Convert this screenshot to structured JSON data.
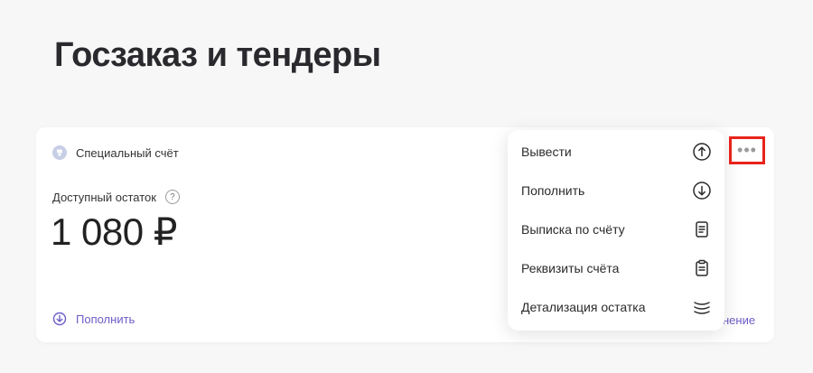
{
  "page": {
    "title": "Госзаказ и тендеры"
  },
  "account": {
    "name": "Специальный счёт",
    "balance_label": "Доступный остаток",
    "balance_amount": "1 080 ₽",
    "help_symbol": "?",
    "topup_label": "Пополнить",
    "partial_link_label": "нение"
  },
  "more_button": {
    "symbol": "•••"
  },
  "menu": {
    "items": [
      {
        "label": "Вывести",
        "icon": "upload-circle-icon"
      },
      {
        "label": "Пополнить",
        "icon": "download-circle-icon"
      },
      {
        "label": "Выписка по счёту",
        "icon": "document-icon"
      },
      {
        "label": "Реквизиты счёта",
        "icon": "clipboard-icon"
      },
      {
        "label": "Детализация остатка",
        "icon": "stack-icon"
      }
    ]
  },
  "colors": {
    "accent": "#6c5ec8",
    "highlight": "#e8231b",
    "background": "#f7f7f8"
  }
}
